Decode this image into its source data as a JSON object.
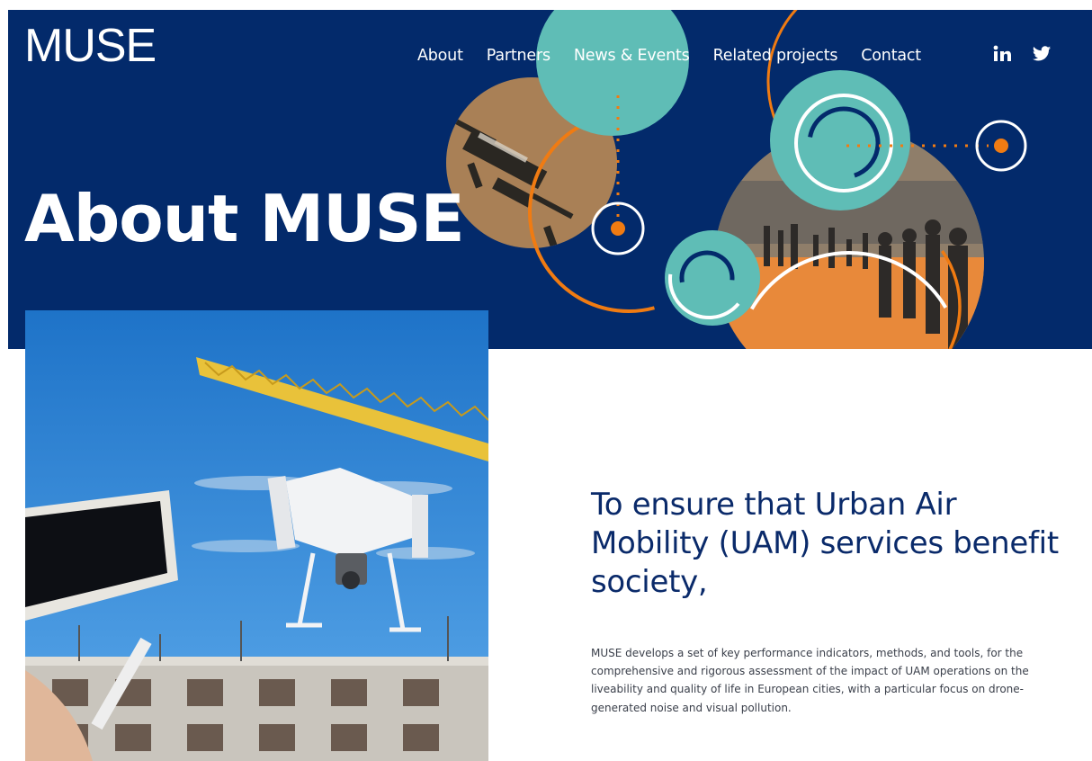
{
  "header": {
    "logo": "MUSE",
    "nav": [
      "About",
      "Partners",
      "News & Events",
      "Related projects",
      "Contact"
    ],
    "social": [
      {
        "name": "linkedin-icon",
        "glyph": "in"
      },
      {
        "name": "twitter-icon",
        "glyph": ""
      }
    ]
  },
  "hero": {
    "title": "About MUSE"
  },
  "main": {
    "headline": "To ensure that Urban Air Mobility (UAM) services benefit society,",
    "description": "MUSE develops a set of key performance indicators, methods, and tools, for the comprehensive and rigorous assessment of the impact of UAM operations on the liveability and quality of life in European cities, with a particular focus on drone-generated noise and visual pollution."
  },
  "colors": {
    "navy": "#032a6b",
    "teal": "#5fbdb6",
    "orange": "#f07b12",
    "heading": "#0a2a6a"
  }
}
